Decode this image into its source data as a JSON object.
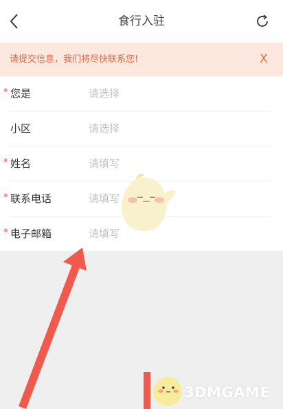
{
  "header": {
    "title": "食行入驻",
    "back_icon": "chevron-left-icon",
    "refresh_icon": "refresh-icon"
  },
  "notice": {
    "text": "请提交信息，我们将尽快联系您!",
    "close_label": "X"
  },
  "form": {
    "rows": [
      {
        "label": "您是",
        "required": true,
        "placeholder": "请选择"
      },
      {
        "label": "小区",
        "required": false,
        "placeholder": "请选择"
      },
      {
        "label": "姓名",
        "required": true,
        "placeholder": "请填写"
      },
      {
        "label": "联系电话",
        "required": true,
        "placeholder": "请填写"
      },
      {
        "label": "电子邮箱",
        "required": true,
        "placeholder": "请填写"
      }
    ],
    "required_mark": "*"
  },
  "watermark": {
    "text": "3DMGAME"
  },
  "colors": {
    "accent": "#ee6a45",
    "arrow": "#ef5a4d",
    "notice_bg": "#fde8df",
    "page_bg": "#efefef"
  }
}
